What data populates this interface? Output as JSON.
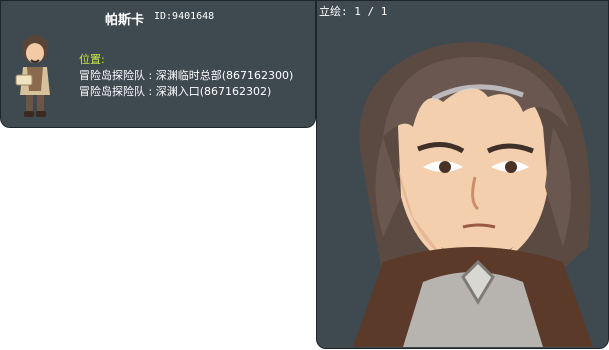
{
  "npc": {
    "name": "帕斯卡",
    "id_label": "ID:9401648"
  },
  "location": {
    "label": "位置:",
    "rows": [
      "冒险岛探险队 : 深渊临时总部(867162300)",
      "冒险岛探险队 : 深渊入口(867162302)"
    ]
  },
  "illustration": {
    "label": "立绘: 1 / 1"
  },
  "colors": {
    "panel_bg": "#3f4950",
    "panel_border": "#1f262b",
    "location_label": "#cce84a",
    "text": "#ffffff"
  }
}
